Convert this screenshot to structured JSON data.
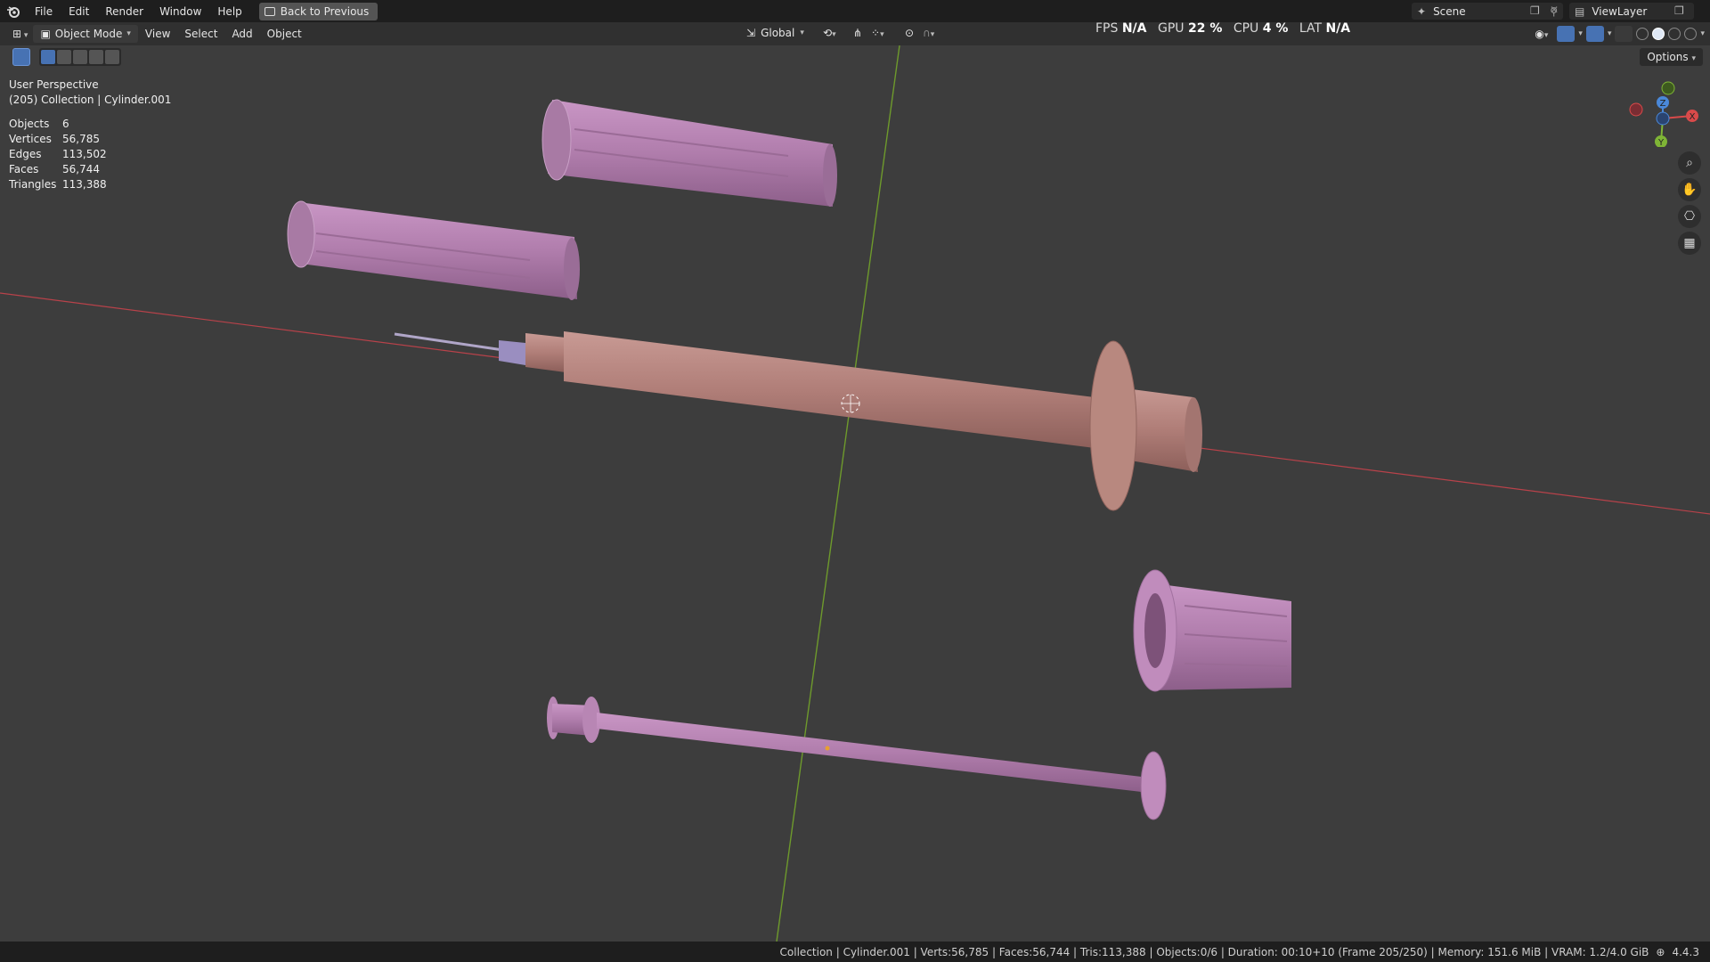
{
  "topbar": {
    "menus": [
      "File",
      "Edit",
      "Render",
      "Window",
      "Help"
    ],
    "back_label": "Back to Previous",
    "scene": "Scene",
    "view_layer": "ViewLayer"
  },
  "header": {
    "mode": "Object Mode",
    "menus": [
      "View",
      "Select",
      "Add",
      "Object"
    ],
    "transform_orientation": "Global",
    "options": "Options"
  },
  "perf": {
    "fps_label": "FPS",
    "fps": "N/A",
    "gpu_label": "GPU",
    "gpu": "22 %",
    "cpu_label": "CPU",
    "cpu": "4 %",
    "lat_label": "LAT",
    "lat": "N/A"
  },
  "viewport": {
    "perspective": "User Perspective",
    "collection": "(205) Collection | Cylinder.001",
    "stats": [
      {
        "label": "Objects",
        "value": "6"
      },
      {
        "label": "Vertices",
        "value": "56,785"
      },
      {
        "label": "Edges",
        "value": "113,502"
      },
      {
        "label": "Faces",
        "value": "56,744"
      },
      {
        "label": "Triangles",
        "value": "113,388"
      }
    ]
  },
  "gizmo": {
    "x": "X",
    "y": "Y",
    "z": "Z"
  },
  "statusbar": {
    "text": "Collection | Cylinder.001 | Verts:56,785 | Faces:56,744 | Tris:113,388 | Objects:0/6 | Duration: 00:10+10 (Frame 205/250) | Memory: 151.6 MiB | VRAM: 1.2/4.0 GiB",
    "version": "4.4.3"
  },
  "colors": {
    "accent": "#4772b3",
    "x_axis": "#d94a4a",
    "y_axis": "#7fb536",
    "z_axis": "#4a88d9",
    "syringe_barrel": "#b58580",
    "parts": "#b886b4"
  },
  "icons": [
    "blender-logo-icon",
    "editor-type-icon",
    "pivot-icon",
    "snap-icon",
    "proportional-icon",
    "overlay-icon",
    "zoom-icon",
    "hand-icon",
    "camera-icon",
    "grid-icon"
  ]
}
